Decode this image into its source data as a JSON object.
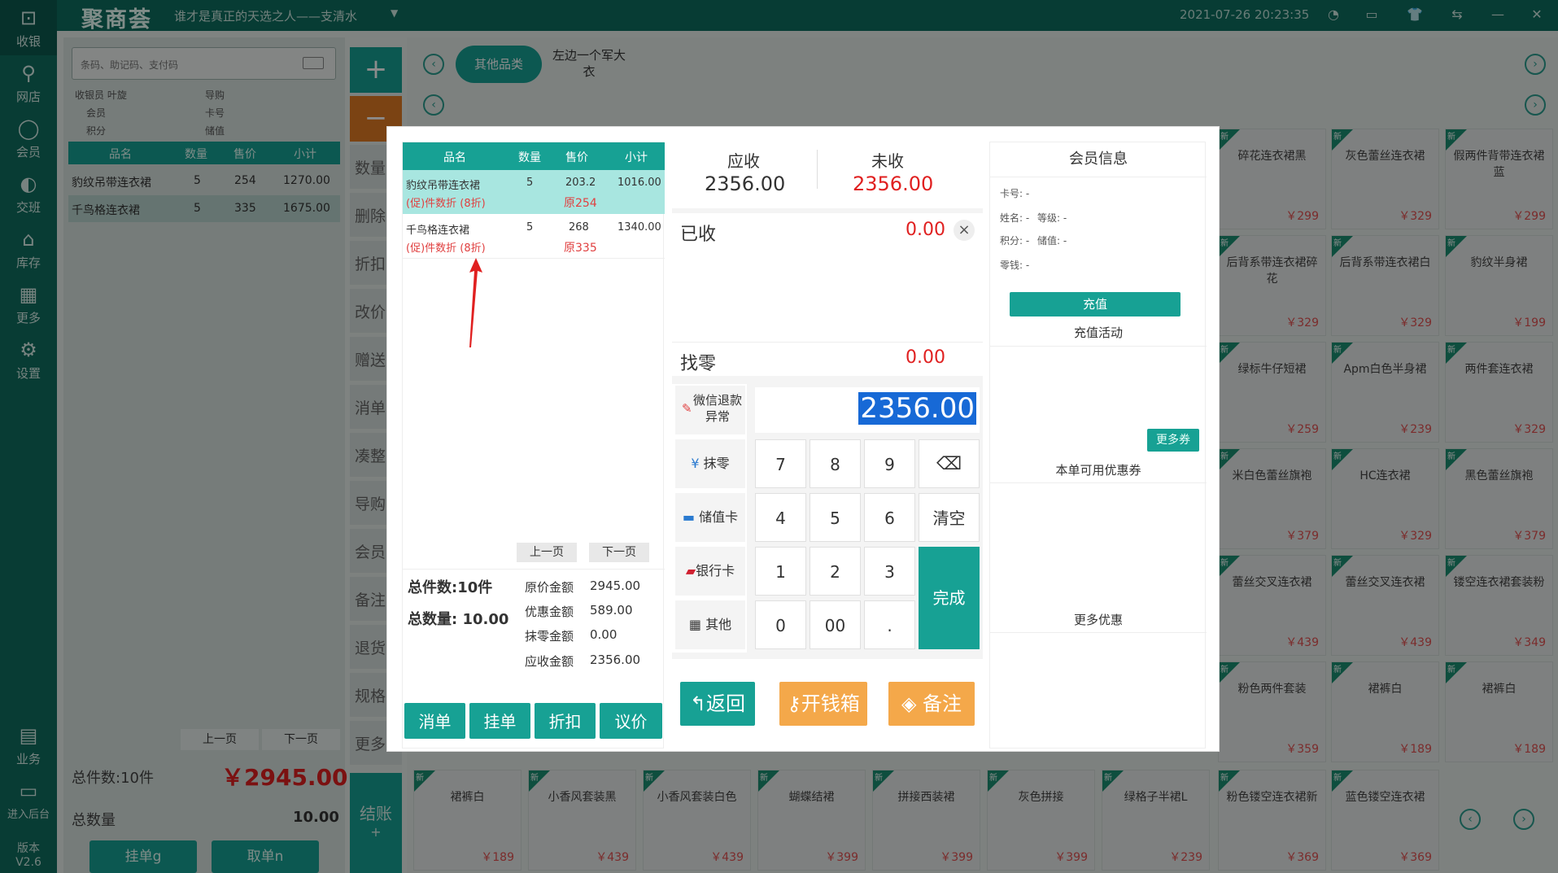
{
  "topbar": {
    "logo": "聚商荟",
    "slogan": "谁才是真正的天选之人——支清水",
    "caret": "▼",
    "datetime": "2021-07-26 20:23:35"
  },
  "nav": [
    {
      "label": "收银",
      "icon": "cashier-icon"
    },
    {
      "label": "网店",
      "icon": "bike-icon"
    },
    {
      "label": "会员",
      "icon": "member-icon"
    },
    {
      "label": "交班",
      "icon": "shift-icon"
    },
    {
      "label": "库存",
      "icon": "warehouse-icon"
    },
    {
      "label": "更多",
      "icon": "grid-icon"
    },
    {
      "label": "设置",
      "icon": "settings-icon"
    },
    {
      "label": "业务",
      "icon": "business-icon"
    },
    {
      "label": "进入后台",
      "icon": "monitor-icon"
    }
  ],
  "version": {
    "label": "版本",
    "value": "V2.6"
  },
  "cart": {
    "search_placeholder": "条码、助记码、支付码",
    "cashier_label": "收银员",
    "cashier": "叶旋",
    "guide_label": "导购",
    "member_label": "会员",
    "card_label": "卡号",
    "points_label": "积分",
    "stored_label": "储值",
    "headers": [
      "品名",
      "数量",
      "售价",
      "小计"
    ],
    "rows": [
      {
        "name": "豹纹吊带连衣裙",
        "qty": "5",
        "price": "254",
        "subtotal": "1270.00"
      },
      {
        "name": "千鸟格连衣裙",
        "qty": "5",
        "price": "335",
        "subtotal": "1675.00"
      }
    ],
    "prev": "上一页",
    "next": "下一页",
    "total_items": "总件数:10件",
    "total_amount": "￥2945.00",
    "total_qty_label": "总数量",
    "total_qty": "10.00",
    "hang_btn": "挂单g",
    "take_btn": "取单n"
  },
  "strip": {
    "plus": "+",
    "minus": "−",
    "items": [
      "数量",
      "删除",
      "折扣",
      "改价",
      "赠送",
      "消单",
      "凑整",
      "导购",
      "会员",
      "备注",
      "退货",
      "规格",
      "更多"
    ],
    "checkout": "结账",
    "checkout_plus": "+"
  },
  "categories": {
    "selected": "其他品类",
    "other": "左边一个军大衣"
  },
  "tiles": [
    {
      "name": "碎花连衣裙黑",
      "price": "￥299"
    },
    {
      "name": "灰色蕾丝连衣裙",
      "price": "￥329"
    },
    {
      "name": "假两件背带连衣裙蓝",
      "price": "￥299"
    },
    {
      "name": "后背系带连衣裙碎花",
      "price": "￥329"
    },
    {
      "name": "后背系带连衣裙白",
      "price": "￥329"
    },
    {
      "name": "豹纹半身裙",
      "price": "￥199"
    },
    {
      "name": "绿标牛仔短裙",
      "price": "￥259"
    },
    {
      "name": "Apm白色半身裙",
      "price": "￥239"
    },
    {
      "name": "两件套连衣裙",
      "price": "￥329"
    },
    {
      "name": "米白色蕾丝旗袍",
      "price": "￥379"
    },
    {
      "name": "HC连衣裙",
      "price": "￥329"
    },
    {
      "name": "黑色蕾丝旗袍",
      "price": "￥379"
    },
    {
      "name": "蕾丝交叉连衣裙",
      "price": "￥439"
    },
    {
      "name": "蕾丝交叉连衣裙",
      "price": "￥439"
    },
    {
      "name": "镂空连衣裙套装粉",
      "price": "￥349"
    },
    {
      "name": "粉色两件套装",
      "price": "￥359"
    },
    {
      "name": "裙裤白",
      "price": "￥189"
    },
    {
      "name": "裙裤白",
      "price": "￥189"
    }
  ],
  "bottom_tiles": [
    {
      "name": "裙裤白",
      "price": "￥189"
    },
    {
      "name": "小香风套装黑",
      "price": "￥439"
    },
    {
      "name": "小香风套装白色",
      "price": "￥439"
    },
    {
      "name": "蝴蝶结裙",
      "price": "￥399"
    },
    {
      "name": "拼接西装裙",
      "price": "￥399"
    },
    {
      "name": "灰色拼接",
      "price": "￥399"
    },
    {
      "name": "绿格子半裙L",
      "price": "￥239"
    },
    {
      "name": "粉色镂空连衣裙新",
      "price": "￥369"
    },
    {
      "name": "蓝色镂空连衣裙",
      "price": "￥369"
    }
  ],
  "tile_tag": "新",
  "modal": {
    "list": {
      "headers": [
        "品名",
        "数量",
        "售价",
        "小计"
      ],
      "rows": [
        {
          "name": "豹纹吊带连衣裙",
          "qty": "5",
          "price": "203.2",
          "subtotal": "1016.00",
          "promo": "(促)件数折 (8折)",
          "orig": "原254"
        },
        {
          "name": "千鸟格连衣裙",
          "qty": "5",
          "price": "268",
          "subtotal": "1340.00",
          "promo": "(促)件数折 (8折)",
          "orig": "原335"
        }
      ],
      "prev": "上一页",
      "next": "下一页",
      "total_items_label": "总件数:",
      "total_items": "10件",
      "total_qty_label": "总数量:",
      "total_qty": "10.00",
      "orig_label": "原价金额",
      "orig_value": "2945.00",
      "discount_label": "优惠金额",
      "discount_value": "589.00",
      "round_label": "抹零金额",
      "round_value": "0.00",
      "due_label": "应收金额",
      "due_value": "2356.00",
      "buttons": [
        "消单",
        "挂单",
        "折扣",
        "议价"
      ]
    },
    "pay": {
      "receivable_label": "应收",
      "receivable": "2356.00",
      "unpaid_label": "未收",
      "unpaid": "2356.00",
      "received_label": "已收",
      "received": "0.00",
      "close": "×",
      "change_label": "找零",
      "change": "0.00",
      "amount_input": "2356.00",
      "methods": [
        {
          "label": "微信退款异常",
          "icon": "pen-icon"
        },
        {
          "label": "抹零",
          "icon": "yen-icon"
        },
        {
          "label": "储值卡",
          "icon": "card-icon"
        },
        {
          "label": "银行卡",
          "icon": "unionpay-icon"
        },
        {
          "label": "其他",
          "icon": "grid-icon"
        }
      ],
      "keys": [
        "7",
        "8",
        "9",
        "4",
        "5",
        "6",
        "1",
        "2",
        "3",
        "0",
        "00",
        "."
      ],
      "clear": "清空",
      "done": "完成",
      "back": "返回",
      "cashbox": "开钱箱",
      "remark": "备注"
    },
    "member": {
      "title": "会员信息",
      "card_label": "卡号:",
      "card": "-",
      "name_label": "姓名:",
      "name": "-",
      "level_label": "等级:",
      "level": "-",
      "points_label": "积分:",
      "points": "-",
      "stored_label": "储值:",
      "stored": "-",
      "change_label": "零钱:",
      "change": "-",
      "recharge": "充值",
      "recharge_activity": "充值活动",
      "more_coupons": "更多券",
      "coupons_title": "本单可用优惠券",
      "more_discounts": "更多优惠"
    }
  },
  "colors": {
    "teal": "#17a194",
    "dark_green": "#0e6d5f",
    "orange": "#f4a84a",
    "red": "#e02020"
  }
}
